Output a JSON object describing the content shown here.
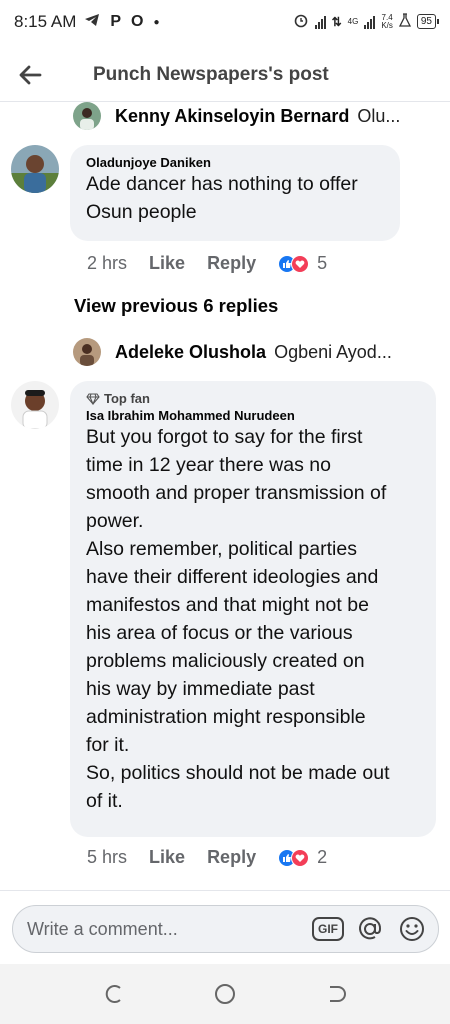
{
  "status_bar": {
    "time": "8:15 AM",
    "left_icons": [
      "telegram-icon",
      "p-icon",
      "opera-icon",
      "dot-icon"
    ],
    "network": "4G",
    "speed": "7.4",
    "speed_unit": "K/s",
    "battery": "95"
  },
  "header": {
    "title": "Punch Newspapers's post"
  },
  "comments": [
    {
      "kind": "reply-collapsed",
      "name": "Kenny Akinseloyin Bernard",
      "preview": "Olu..."
    },
    {
      "kind": "comment",
      "author": "Oladunjoye Daniken",
      "text": "Ade dancer has nothing to offer\nOsun people",
      "time": "2 hrs",
      "like_label": "Like",
      "reply_label": "Reply",
      "reaction_count": "5"
    },
    {
      "kind": "view-previous",
      "label": "View previous 6 replies"
    },
    {
      "kind": "reply-collapsed",
      "name": "Adeleke Olushola",
      "preview": "Ogbeni Ayod..."
    },
    {
      "kind": "comment",
      "badge": "Top fan",
      "author": "Isa Ibrahim Mohammed Nurudeen",
      "text": "But you forgot to say for the first\ntime in 12 year there was no\nsmooth and proper transmission of\npower.\nAlso remember, political parties\nhave their different ideologies and\nmanifestos and that might not be\nhis area of focus or the various\nproblems maliciously created on\nhis way by immediate past\nadministration might responsible\nfor it.\nSo, politics should not be made out\nof it.",
      "time": "5 hrs",
      "like_label": "Like",
      "reply_label": "Reply",
      "reaction_count": "2"
    }
  ],
  "composer": {
    "placeholder": "Write a comment...",
    "gif_label": "GIF"
  },
  "colors": {
    "bubble_bg": "#f0f2f5",
    "like_blue": "#1877f2",
    "love_red": "#f33e58",
    "meta_gray": "#65676b"
  }
}
